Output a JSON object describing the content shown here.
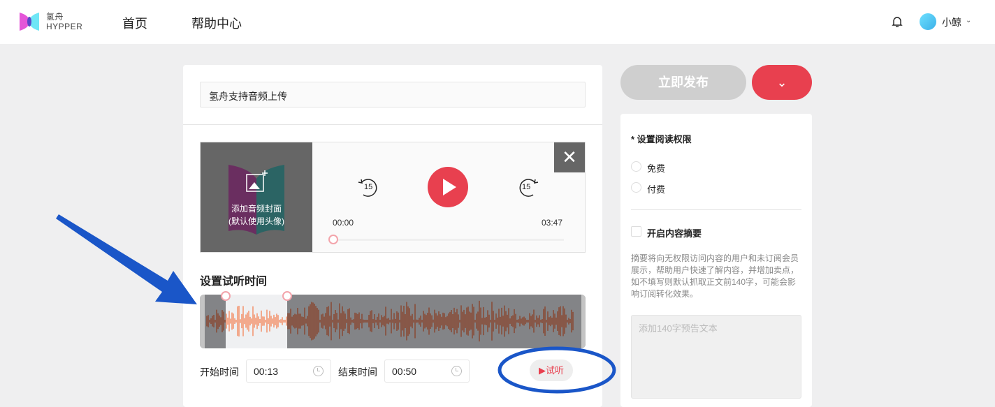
{
  "header": {
    "logo_cn": "氢舟",
    "logo_en": "HYPPER",
    "nav": [
      "首页",
      "帮助中心"
    ],
    "username": "小鲸"
  },
  "editor": {
    "title": "氢舟支持音频上传",
    "player": {
      "cover_label": "添加音频封面",
      "cover_hint": "(默认使用头像)",
      "rewind": "15",
      "forward": "15",
      "current_time": "00:00",
      "duration": "03:47",
      "progress": 0
    },
    "trial": {
      "heading": "设置试听时间",
      "start_label": "开始时间",
      "start_value": "00:13",
      "end_label": "结束时间",
      "end_value": "00:50",
      "play_label": "试听"
    }
  },
  "sidebar": {
    "publish": "立即发布",
    "permission_title": "* 设置阅读权限",
    "options": [
      "免费",
      "付费"
    ],
    "summary_label": "开启内容摘要",
    "summary_desc": "摘要将向无权限访问内容的用户和未订阅会员展示，帮助用户快速了解内容，并增加卖点，如不填写则默认抓取正文前140字，可能会影响订阅转化效果。",
    "summary_placeholder": "添加140字预告文本"
  },
  "colors": {
    "accent": "#e8404f",
    "annotation": "#1a56c8"
  }
}
